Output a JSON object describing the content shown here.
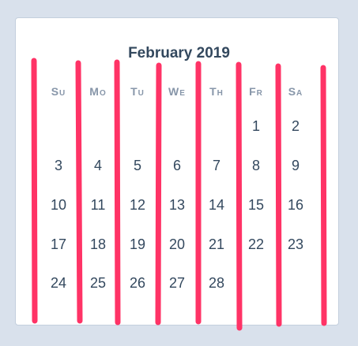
{
  "calendar": {
    "month_title": "February 2019",
    "weekdays": [
      {
        "cap": "S",
        "rest": "U"
      },
      {
        "cap": "M",
        "rest": "O"
      },
      {
        "cap": "T",
        "rest": "U"
      },
      {
        "cap": "W",
        "rest": "E"
      },
      {
        "cap": "T",
        "rest": "H"
      },
      {
        "cap": "F",
        "rest": "R"
      },
      {
        "cap": "S",
        "rest": "A"
      }
    ],
    "weeks": [
      [
        "",
        "",
        "",
        "",
        "",
        "1",
        "2"
      ],
      [
        "3",
        "4",
        "5",
        "6",
        "7",
        "8",
        "9"
      ],
      [
        "10",
        "11",
        "12",
        "13",
        "14",
        "15",
        "16"
      ],
      [
        "17",
        "18",
        "19",
        "20",
        "21",
        "22",
        "23"
      ],
      [
        "24",
        "25",
        "26",
        "27",
        "28",
        "",
        ""
      ]
    ]
  },
  "overlay": {
    "line_color": "#ff3366"
  }
}
